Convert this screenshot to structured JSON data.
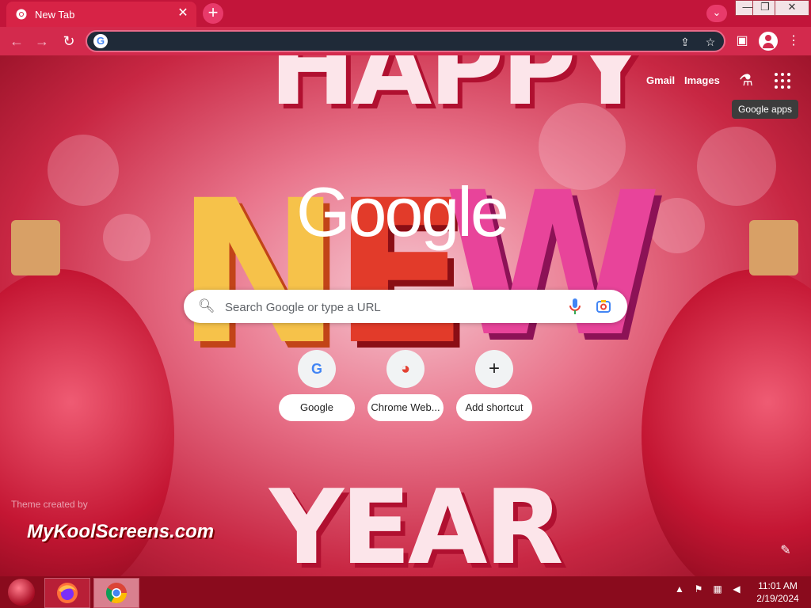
{
  "tab": {
    "title": "New Tab",
    "close": "✕"
  },
  "window": {
    "minimize": "—",
    "restore": "❐",
    "close": "✕"
  },
  "toolbar": {
    "back": "←",
    "forward": "→",
    "reload": "↻",
    "omnibox_value": "",
    "share": "⇪",
    "bookmark": "☆",
    "sidepanel": "▣",
    "menu": "⋮"
  },
  "ntp": {
    "gmail": "Gmail",
    "images": "Images",
    "apps_tooltip": "Google apps",
    "logo": "Google",
    "search_placeholder": "Search Google or type a URL",
    "shortcuts": [
      {
        "label": "Google",
        "icon": "G"
      },
      {
        "label": "Chrome Web...",
        "icon": "◕"
      },
      {
        "label": "Add shortcut",
        "icon": "+"
      }
    ],
    "theme_credit": "Theme created by",
    "theme_brand": "MyKoolScreens.com",
    "background_text": {
      "top": "HAPPY",
      "middle": [
        "N",
        "E",
        "W"
      ],
      "bottom": "YEAR"
    }
  },
  "taskbar": {
    "apps": [
      "firefox-icon",
      "chrome-icon"
    ],
    "time": "11:01 AM",
    "date": "2/19/2024",
    "tray": {
      "arrow": "▲",
      "flag": "⚑",
      "network": "▦",
      "volume": "◀"
    }
  },
  "colors": {
    "theme": "#c82743",
    "tooltip": "#3c3c3c"
  }
}
